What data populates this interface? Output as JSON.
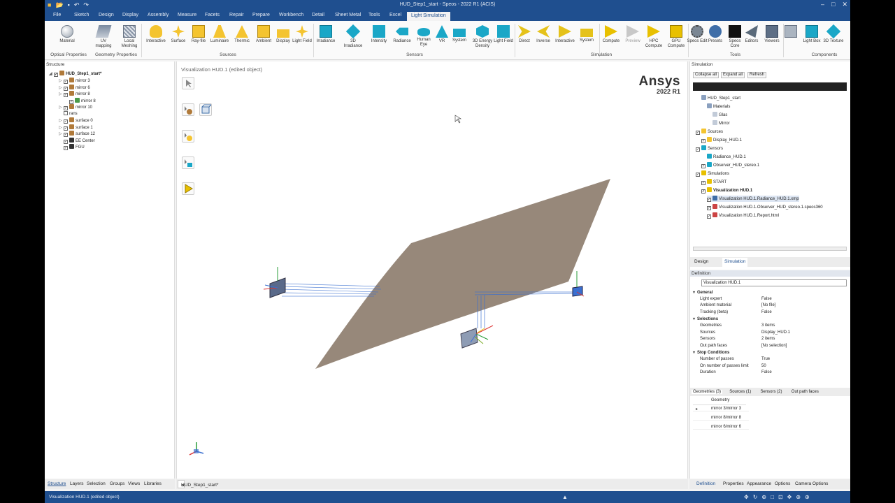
{
  "window": {
    "title": "HUD_Step1_start - Speos - 2022 R1 (ACIS)"
  },
  "menu": {
    "file": "File",
    "sketch": "Sketch",
    "design": "Design",
    "display": "Display",
    "assembly": "Assembly",
    "measure": "Measure",
    "facets": "Facets",
    "repair": "Repair",
    "prepare": "Prepare",
    "workbench": "Workbench",
    "detail": "Detail",
    "sheet_metal": "Sheet Metal",
    "tools": "Tools",
    "excel": "Excel",
    "light_simulation": "Light Simulation"
  },
  "ribbon": {
    "material": "Material",
    "uv_mapping": "UV mapping",
    "local_meshing": "Local Meshing",
    "interactive_src": "Interactive",
    "surface": "Surface",
    "ray_file": "Ray-file",
    "luminaire": "Luminaire",
    "thermic": "Thermic",
    "ambient": "Ambient",
    "display": "Display",
    "light_field": "Light Field",
    "irradiance": "Irradiance",
    "irradiance_3d": "3D Irradiance",
    "intensity": "Intensity",
    "radiance": "Radiance",
    "human_eye": "Human Eye",
    "vr": "VR",
    "system": "System",
    "energy_3d": "3D Energy Density",
    "light_field2": "Light Field",
    "direct": "Direct",
    "inverse": "Inverse",
    "interactive_sim": "Interactive",
    "system_sim": "System",
    "compute": "Compute",
    "preview": "Preview",
    "hpc_compute": "HPC Compute",
    "gpu_compute": "GPU Compute",
    "speos_edit": "Speos Edit",
    "presets": "Presets",
    "speos_core": "Speos Core",
    "editors": "Editors",
    "viewers": "Viewers",
    "light_box": "Light Box",
    "texture_3d": "3D Texture",
    "g_optical": "Optical Properties",
    "g_geometry": "Geometry Properties",
    "g_sources": "Sources",
    "g_sensors": "Sensors",
    "g_simulation": "Simulation",
    "g_tools": "Tools",
    "g_components": "Components"
  },
  "structure": {
    "title": "Structure",
    "root": "HUD_Step1_start*",
    "items": [
      "mirror 3",
      "mirror 6",
      "mirror 8",
      "mirror 8",
      "mirror 10",
      "rans",
      "surface 0",
      "surface 1",
      "surface 12",
      "EE Center",
      "FGU"
    ]
  },
  "viewport": {
    "label": "Visualization HUD.1 (edited object)",
    "brand": "Ansys",
    "version": "2022 R1"
  },
  "simulation_panel": {
    "title": "Simulation",
    "collapse_all": "Collapse all",
    "expand_all": "Expand all",
    "refresh": "Refresh",
    "tree": [
      "HUD_Step1_start",
      "Materials",
      "Glas",
      "Mirror",
      "Sources",
      "Display_HUD.1",
      "Sensors",
      "Radiance_HUD.1",
      "Observer_HUD_stereo.1",
      "Simulations",
      "START",
      "Visualization HUD.1",
      "Visualization HUD.1.Radiance_HUD.1.xmp",
      "Visualization HUD.1.Observer_HUD_stereo.1.speos360",
      "Visualization HUD.1.Report.html"
    ],
    "tab_design": "Design",
    "tab_simulation": "Simulation"
  },
  "definition_panel": {
    "title": "Definition",
    "name_value": "Visualization HUD.1",
    "general": "General",
    "light_expert": "Light expert",
    "light_expert_v": "False",
    "ambient_material": "Ambient material",
    "ambient_material_v": "[No file]",
    "tracking": "Tracking (beta)",
    "tracking_v": "False",
    "selections": "Selections",
    "geometries": "Geometries",
    "geometries_v": "3 items",
    "sources": "Sources",
    "sources_v": "Display_HUD.1",
    "sensors": "Sensors",
    "sensors_v": "2 items",
    "out_path_faces": "Out path faces",
    "out_path_faces_v": "[No selection]",
    "stop": "Stop Conditions",
    "num_passes": "Number of passes",
    "num_passes_v": "True",
    "passes_limit": "On number of passes limit",
    "passes_limit_v": "50",
    "duration": "Duration",
    "duration_v": "False",
    "tabs": [
      "Geometries (3)",
      "Sources (1)",
      "Sensors (2)",
      "Out path faces"
    ],
    "geometry_header": "Geometry",
    "geometry_rows": [
      "mirror 3/mirror 3",
      "mirror 8/mirror 8",
      "mirror 6/mirror 6"
    ]
  },
  "bottom_left_tabs": [
    "Structure",
    "Layers",
    "Selection",
    "Groups",
    "Views",
    "Libraries"
  ],
  "doc_tab": "HUD_Step1_start*",
  "bottom_right_tabs": [
    "Definition",
    "Properties",
    "Appearance",
    "Options",
    "Camera Options"
  ],
  "status": {
    "text": "Visualization HUD.1 (edited object)"
  },
  "colors": {
    "accent": "#1f4f8f",
    "mirror_surface": "#8c7b6b",
    "ray_blue": "#3a6fd0"
  }
}
